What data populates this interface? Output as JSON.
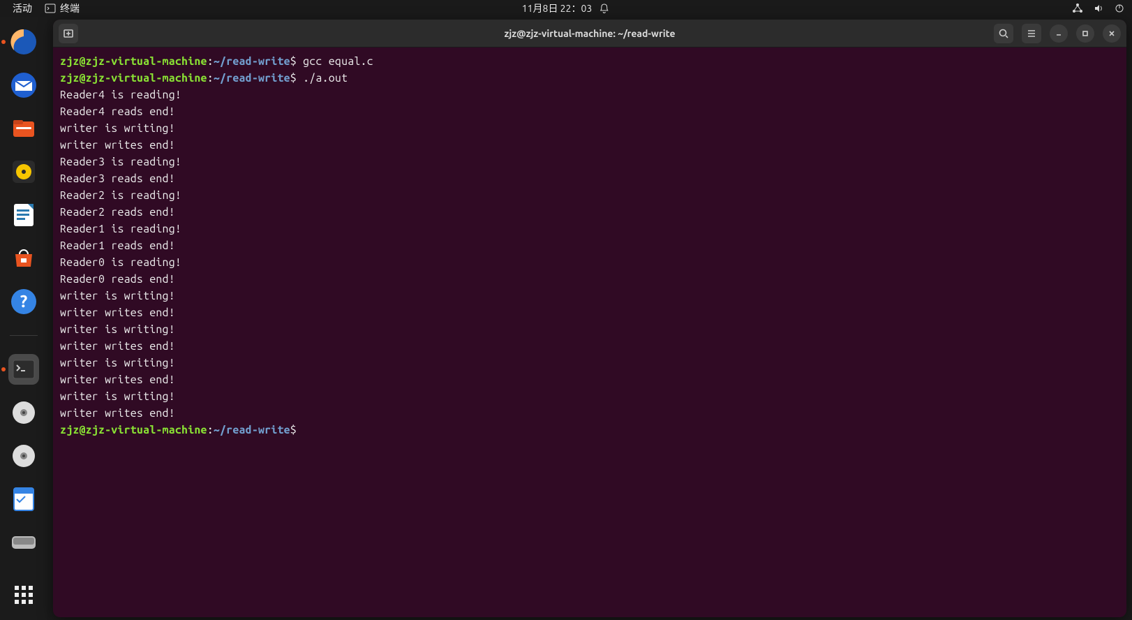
{
  "topbar": {
    "activities": "活动",
    "app_name": "终端",
    "datetime": "11月8日 22：03"
  },
  "window": {
    "title": "zjz@zjz-virtual-machine: ~/read-write"
  },
  "prompt": {
    "user_host": "zjz@zjz-virtual-machine",
    "colon": ":",
    "path": "~/read-write",
    "dollar": "$"
  },
  "lines": [
    {
      "type": "prompt",
      "cmd": "gcc equal.c"
    },
    {
      "type": "prompt",
      "cmd": "./a.out"
    },
    {
      "type": "out",
      "text": "Reader4 is reading!"
    },
    {
      "type": "out",
      "text": "Reader4 reads end!"
    },
    {
      "type": "out",
      "text": "writer is writing!"
    },
    {
      "type": "out",
      "text": "writer writes end!"
    },
    {
      "type": "out",
      "text": "Reader3 is reading!"
    },
    {
      "type": "out",
      "text": "Reader3 reads end!"
    },
    {
      "type": "out",
      "text": "Reader2 is reading!"
    },
    {
      "type": "out",
      "text": "Reader2 reads end!"
    },
    {
      "type": "out",
      "text": "Reader1 is reading!"
    },
    {
      "type": "out",
      "text": "Reader1 reads end!"
    },
    {
      "type": "out",
      "text": "Reader0 is reading!"
    },
    {
      "type": "out",
      "text": "Reader0 reads end!"
    },
    {
      "type": "out",
      "text": "writer is writing!"
    },
    {
      "type": "out",
      "text": "writer writes end!"
    },
    {
      "type": "out",
      "text": "writer is writing!"
    },
    {
      "type": "out",
      "text": "writer writes end!"
    },
    {
      "type": "out",
      "text": "writer is writing!"
    },
    {
      "type": "out",
      "text": "writer writes end!"
    },
    {
      "type": "out",
      "text": "writer is writing!"
    },
    {
      "type": "out",
      "text": "writer writes end!"
    },
    {
      "type": "prompt",
      "cmd": ""
    }
  ],
  "dock": {
    "items": [
      "firefox-icon",
      "thunderbird-icon",
      "files-icon",
      "rhythmbox-icon",
      "libreoffice-writer-icon",
      "ubuntu-software-icon",
      "help-icon",
      "terminal-icon",
      "disc1-icon",
      "disc2-icon",
      "todo-icon",
      "device-icon",
      "show-apps-icon"
    ]
  }
}
